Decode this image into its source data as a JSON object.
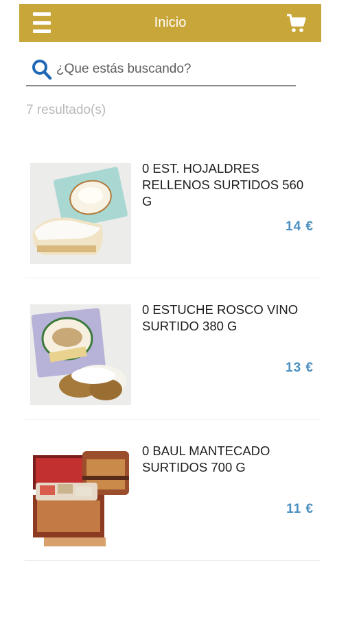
{
  "header": {
    "title": "Inicio",
    "bar_color": "#c9a63a",
    "menu_icon": "hamburger-menu-icon",
    "cart_icon": "shopping-cart-icon"
  },
  "search": {
    "placeholder": "¿Que estás buscando?",
    "icon": "search-icon",
    "icon_color": "#1f68b5"
  },
  "results_text": "7 resultado(s)",
  "products": [
    {
      "name": "0 EST. HOJALDRES RELLENOS SURTIDOS 560 G",
      "price": "14 €"
    },
    {
      "name": "0 ESTUCHE ROSCO VINO SURTIDO 380 G",
      "price": "13 €"
    },
    {
      "name": "0 BAUL MANTECADO SURTIDOS 700 G",
      "price": "11 €"
    }
  ],
  "price_color": "#4a8fc0"
}
